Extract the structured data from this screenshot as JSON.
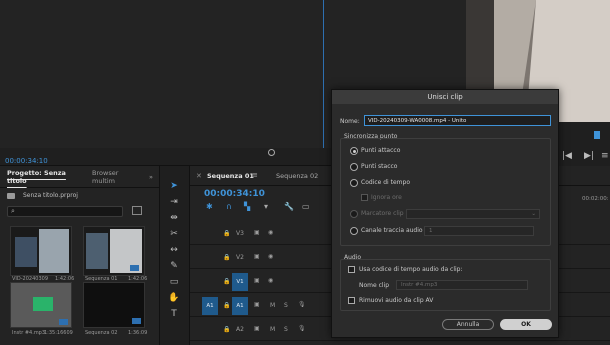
{
  "monitor": {
    "timecode": "00:00:34:10"
  },
  "program": {
    "timecode_partial": "00:02:00:"
  },
  "project": {
    "tabs": [
      "Progetto: Senza titolo",
      "Browser multim"
    ],
    "file_name": "Senza titolo.prproj",
    "items": [
      {
        "name": "VID-20240309",
        "duration": "1:42:06"
      },
      {
        "name": "Sequenza 01",
        "duration": "1:42:06"
      },
      {
        "name": "Instr #4.mp3",
        "duration": "1:35:16609"
      },
      {
        "name": "Sequenza 02",
        "duration": "1:36:09"
      }
    ]
  },
  "timeline": {
    "tabs": [
      "Sequenza 01",
      "Sequenza 02"
    ],
    "timecode": "00:00:34:10",
    "tracks": [
      {
        "label": "V3",
        "target": ""
      },
      {
        "label": "V2",
        "target": ""
      },
      {
        "label": "V1",
        "target": "V1"
      },
      {
        "label": "A1",
        "target": "A1",
        "src": "A1"
      },
      {
        "label": "A2",
        "target": ""
      }
    ],
    "mute_label": "M",
    "solo_label": "S"
  },
  "dialog": {
    "title": "Unisci clip",
    "name_label": "Nome:",
    "name_value": "VID-20240309-WA0008.mp4 - Unito",
    "sync_heading": "Sincronizza punto",
    "sync_options": [
      {
        "label": "Punti attacco",
        "selected": true
      },
      {
        "label": "Punti stacco",
        "selected": false
      },
      {
        "label": "Codice di tempo",
        "selected": false
      },
      {
        "label": "Marcatore clip",
        "selected": false,
        "disabled": true
      },
      {
        "label": "Canale traccia audio",
        "selected": false
      }
    ],
    "ignore_hours": "Ignora ore",
    "channel_value": "1",
    "audio_heading": "Audio",
    "use_audio_tc": "Usa codice di tempo audio da clip:",
    "clip_name_label": "Nome clip",
    "clip_name_value": "Instr #4.mp3",
    "remove_av_audio": "Rimuovi audio da clip AV",
    "cancel_label": "Annulla",
    "ok_label": "OK"
  },
  "colors": {
    "accent": "#3f93d8",
    "track_target": "#1f5a8c"
  }
}
